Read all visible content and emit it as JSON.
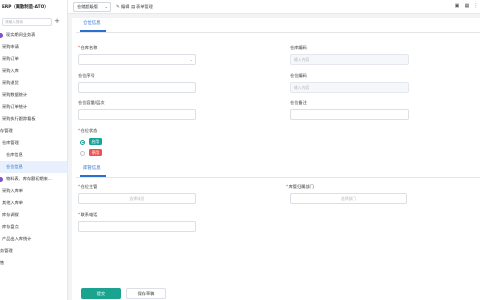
{
  "app": {
    "title": "ERP（离散制造-ATO）"
  },
  "sidebar": {
    "search_placeholder": "请输入搜索",
    "add_icon": "plus-icon",
    "items": [
      {
        "label": "现实期间业务表"
      },
      {
        "label": "采购申请"
      },
      {
        "label": "采购订单"
      },
      {
        "label": "采购入库"
      },
      {
        "label": "采购退货"
      },
      {
        "label": "采购数据统计"
      },
      {
        "label": "采购订单统计"
      },
      {
        "label": "采购执行跟踪看板"
      },
      {
        "label": "存管理"
      },
      {
        "label": "仓库管理"
      },
      {
        "label": "仓库信息"
      },
      {
        "label": "仓位信息"
      },
      {
        "label": "物料表、库存额初期来..."
      },
      {
        "label": "采购入库单"
      },
      {
        "label": "其他入库单"
      },
      {
        "label": "库存调拨"
      },
      {
        "label": "库存盘点"
      },
      {
        "label": "产品出入库统计"
      },
      {
        "label": "务管理"
      },
      {
        "label": "售"
      }
    ]
  },
  "topbar": {
    "select_value": "仓储超级版",
    "edit_label": "编辑",
    "form_manage_label": "表单管理",
    "icons": [
      "edit-icon",
      "form-manage-icon",
      "print-icon",
      "grid-icon",
      "more-icon"
    ]
  },
  "form": {
    "section1_tab": "仓位信息",
    "section2_tab": "库管信息",
    "warehouse_name": {
      "label": "仓库名称",
      "required": "*",
      "value": ""
    },
    "warehouse_code": {
      "label": "仓库编码",
      "placeholder": "输入内容"
    },
    "location_no": {
      "label": "仓位序号",
      "value": ""
    },
    "location_code": {
      "label": "仓位编码",
      "placeholder": "输入内容"
    },
    "location_capacity": {
      "label": "仓位容量/层次",
      "value": ""
    },
    "location_note": {
      "label": "仓位备注",
      "value": ""
    },
    "location_status": {
      "label": "仓位状态",
      "required": "*",
      "options": [
        {
          "label": "启用",
          "color": "#19a39a",
          "selected": true
        },
        {
          "label": "停用",
          "color": "#ef5350",
          "selected": false
        }
      ]
    },
    "keeper": {
      "label": "仓位主管",
      "required": "*",
      "placeholder": "选择成员"
    },
    "keeper_dept": {
      "label": "库管归属部门",
      "required": "*",
      "placeholder": "选择部门"
    },
    "contact_phone": {
      "label": "联系电话",
      "required": "*",
      "value": ""
    }
  },
  "actions": {
    "submit_label": "提交",
    "save_draft_label": "保存草稿"
  },
  "colors": {
    "accent": "#2b6fd1",
    "primary_button": "#1aa38f",
    "sidebar_dot": "#7b52c8"
  }
}
